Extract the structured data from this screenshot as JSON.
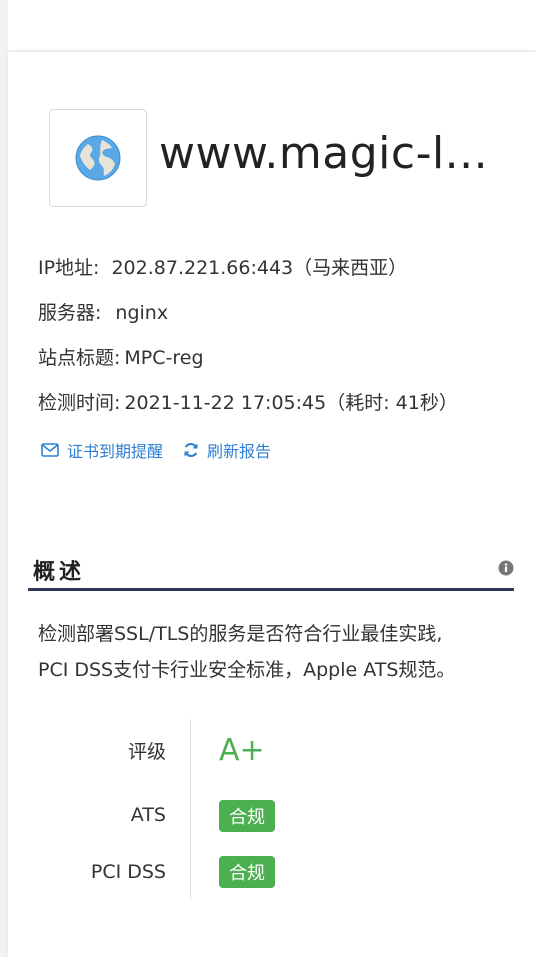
{
  "site": {
    "title": "www.magic-l...",
    "icon": "globe-icon"
  },
  "info": {
    "ip_label": "IP地址:",
    "ip_value": "202.87.221.66:443（马来西亚）",
    "server_label": "服务器:",
    "server_value": "nginx",
    "site_title_label": "站点标题:",
    "site_title_value": "MPC-reg",
    "check_time_label": "检测时间:",
    "check_time_value": "2021-11-22 17:05:45（耗时: 41秒）"
  },
  "actions": {
    "cert_reminder": "证书到期提醒",
    "refresh_report": "刷新报告"
  },
  "overview": {
    "title": "概述",
    "description_line1": "检测部署SSL/TLS的服务是否符合行业最佳实践,",
    "description_line2": "PCI DSS支付卡行业安全标准，Apple ATS规范。"
  },
  "grades": {
    "rating_label": "评级",
    "rating_value": "A+",
    "ats_label": "ATS",
    "ats_value": "合规",
    "pci_label": "PCI DSS",
    "pci_value": "合规"
  },
  "colors": {
    "accent_blue": "#2d7fd1",
    "success_green": "#4caf50",
    "section_rule": "#2b3a55"
  }
}
